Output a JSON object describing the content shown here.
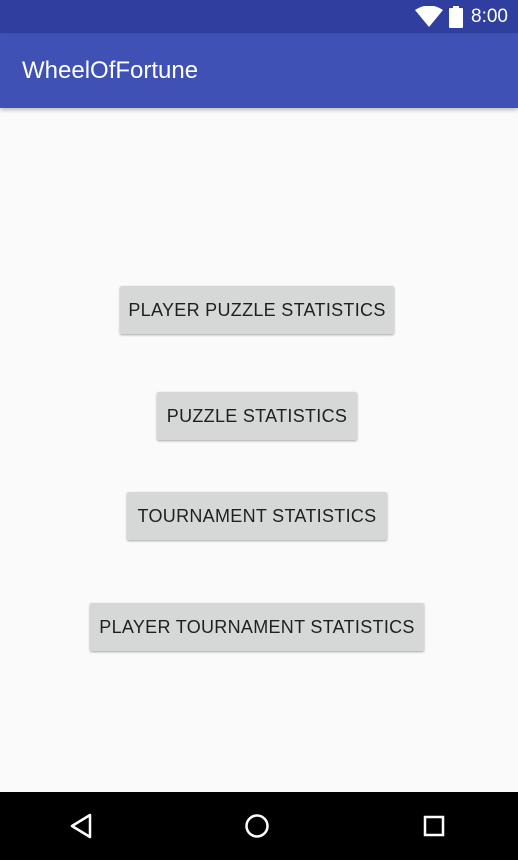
{
  "status_bar": {
    "time": "8:00",
    "icons": [
      "wifi-icon",
      "battery-icon"
    ],
    "background_color": "#303f9f"
  },
  "app_bar": {
    "title": "WheelOfFortune",
    "background_color": "#3f51b5"
  },
  "main": {
    "buttons": [
      {
        "label": "PLAYER PUZZLE STATISTICS"
      },
      {
        "label": "PUZZLE STATISTICS"
      },
      {
        "label": "TOURNAMENT STATISTICS"
      },
      {
        "label": "PLAYER TOURNAMENT STATISTICS"
      }
    ],
    "button_color": "#d6d7d7"
  },
  "nav_bar": {
    "icons": [
      "back-icon",
      "home-icon",
      "recents-icon"
    ],
    "background_color": "#000000"
  }
}
